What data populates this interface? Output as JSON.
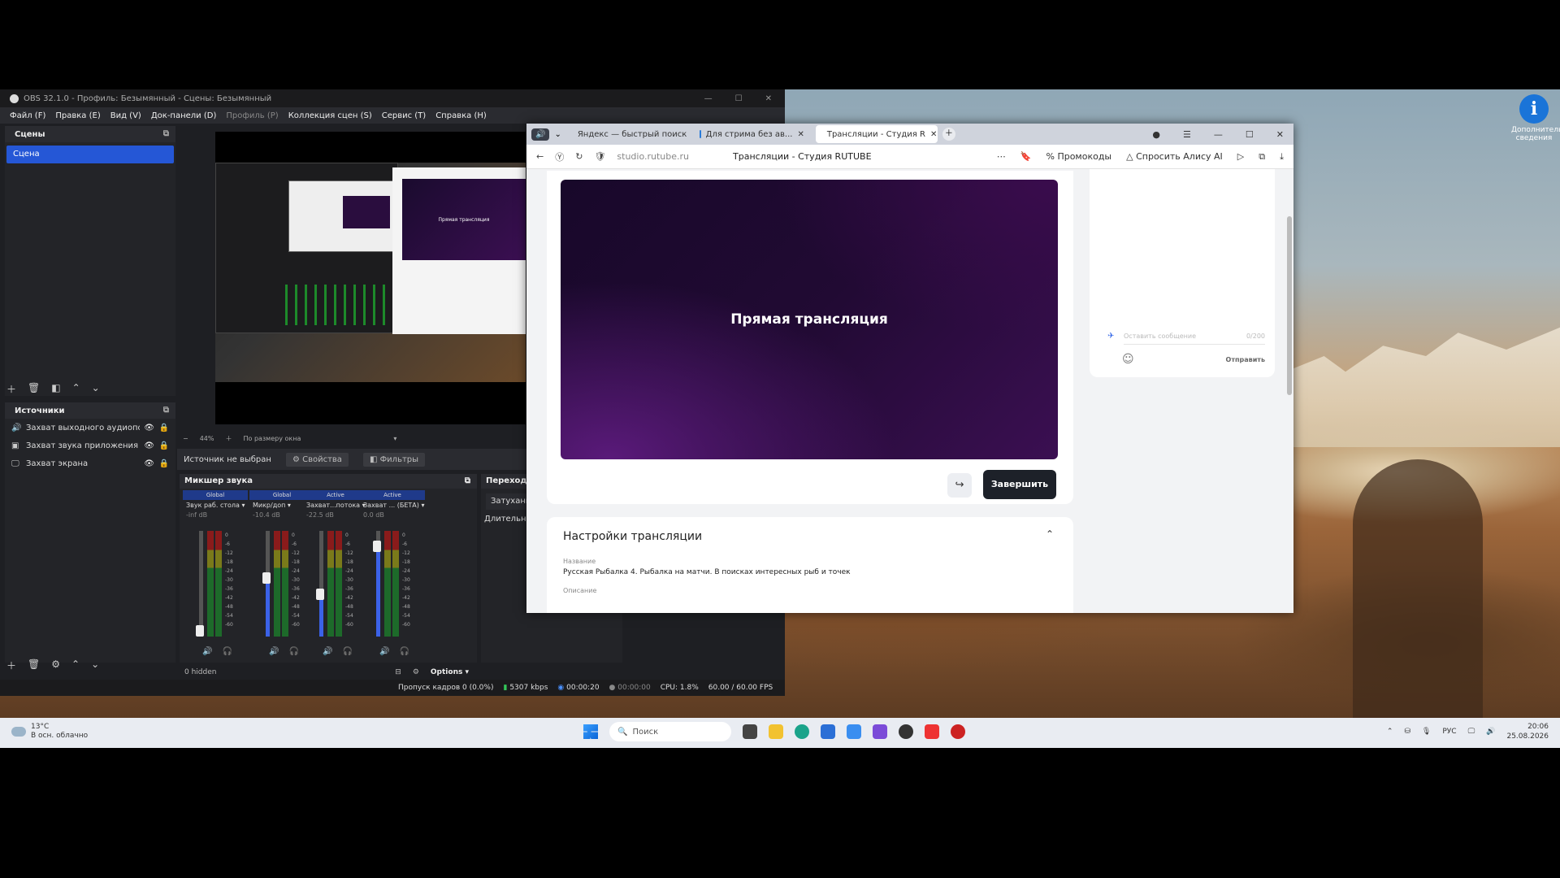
{
  "desktop": {
    "icon_label": "Дополнительные сведения"
  },
  "obs": {
    "title": "OBS 32.1.0 - Профиль: Безымянный - Сцены: Безымянный",
    "menu": [
      "Файл (F)",
      "Правка (E)",
      "Вид (V)",
      "Док-панели (D)",
      "Профиль (P)",
      "Коллекция сцен (S)",
      "Сервис (T)",
      "Справка (H)"
    ],
    "scenes": {
      "header": "Сцены",
      "items": [
        "Сцена"
      ]
    },
    "sources": {
      "header": "Источники",
      "items": [
        "Захват выходного аудиопотока",
        "Захват звука приложения (БЕТА)",
        "Захват экрана"
      ]
    },
    "preview_bar": {
      "zoom": "44%",
      "fit": "По размеру окна"
    },
    "source_bar": {
      "none": "Источник не выбран",
      "props": "Свойства",
      "filters": "Фильтры"
    },
    "mixer": {
      "header": "Микшер звука",
      "channels": [
        {
          "tag": "Global",
          "name": "Звук раб. стола",
          "db": "-inf dB",
          "level": 0.05
        },
        {
          "tag": "Global",
          "name": "Микр/доп",
          "db": "-10.4 dB",
          "level": 0.55
        },
        {
          "tag": "Active",
          "name": "Захват...потока",
          "db": "-22.5 dB",
          "level": 0.4
        },
        {
          "tag": "Active",
          "name": "Захват ... (БЕТА)",
          "db": "0.0 dB",
          "level": 0.85
        }
      ],
      "scale": [
        "0",
        "-6",
        "-12",
        "-18",
        "-24",
        "-30",
        "-36",
        "-42",
        "-48",
        "-54",
        "-60"
      ],
      "hidden": "0 hidden",
      "options": "Options"
    },
    "transitions": {
      "header": "Переходы",
      "value": "Затухание",
      "duration": "Длительность"
    },
    "status": {
      "dropped": "Пропуск кадров 0 (0.0%)",
      "bitrate": "5307 kbps",
      "stream_time": "00:00:20",
      "rec_time": "00:00:00",
      "cpu": "CPU: 1.8%",
      "fps": "60.00 / 60.00 FPS"
    }
  },
  "browser": {
    "tabs": [
      "Яндекс — быстрый поиск",
      "Для стрима без ав...",
      "Трансляции - Студия R"
    ],
    "url": "studio.rutube.ru",
    "page_title": "Трансляции - Студия RUTUBE",
    "promo": "Промокоды",
    "alice": "Спросить Алису AI",
    "video_label": "Прямая трансляция",
    "finish_button": "Завершить",
    "chat": {
      "placeholder": "Оставить сообщение",
      "counter": "0/200",
      "send": "Отправить"
    },
    "settings": {
      "header": "Настройки трансляции",
      "name_label": "Название",
      "name_value": "Русская Рыбалка 4. Рыбалка на матчи. В поисках интересных рыб и точек",
      "desc_label": "Описание"
    }
  },
  "taskbar": {
    "weather_temp": "13°C",
    "weather_desc": "В осн. облачно",
    "search": "Поиск",
    "lang": "РУС",
    "time": "20:06",
    "date": "25.08.2026"
  }
}
